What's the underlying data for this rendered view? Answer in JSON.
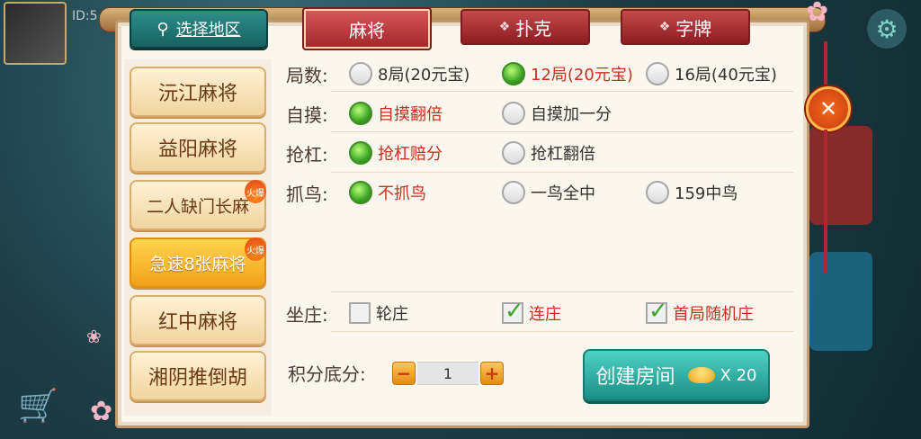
{
  "background": {
    "id_label": "ID:5",
    "gear_icon": "gear-icon"
  },
  "region_tab": {
    "label": "选择地区",
    "icon": "location-pin-icon"
  },
  "top_tabs": [
    {
      "label": "麻将",
      "active": true
    },
    {
      "label": "扑克",
      "active": false
    },
    {
      "label": "字牌",
      "active": false
    }
  ],
  "sidebar": {
    "items": [
      {
        "label": "沅江麻将",
        "active": false,
        "hot": false
      },
      {
        "label": "益阳麻将",
        "active": false,
        "hot": false
      },
      {
        "label": "二人缺门长麻",
        "active": false,
        "hot": true
      },
      {
        "label": "急速8张麻将",
        "active": true,
        "hot": true
      },
      {
        "label": "红中麻将",
        "active": false,
        "hot": false
      },
      {
        "label": "湘阴推倒胡",
        "active": false,
        "hot": false
      }
    ],
    "hot_badge": "火爆"
  },
  "settings": {
    "rounds": {
      "label": "局数:",
      "options": [
        "8局(20元宝)",
        "12局(20元宝)",
        "16局(40元宝)"
      ],
      "selected": 1
    },
    "self_draw": {
      "label": "自摸:",
      "options": [
        "自摸翻倍",
        "自摸加一分"
      ],
      "selected": 0
    },
    "kong": {
      "label": "抢杠:",
      "options": [
        "抢杠赔分",
        "抢杠翻倍"
      ],
      "selected": 0
    },
    "bird": {
      "label": "抓鸟:",
      "options": [
        "不抓鸟",
        "一鸟全中",
        "159中鸟"
      ],
      "selected": 0
    },
    "dealer": {
      "label": "坐庄:",
      "options": [
        "轮庄",
        "连庄",
        "首局随机庄"
      ],
      "checked": [
        false,
        true,
        true
      ]
    }
  },
  "score": {
    "label": "积分底分:",
    "value": "1",
    "minus": "−",
    "plus": "+"
  },
  "create_button": {
    "label": "创建房间",
    "cost": "X 20"
  },
  "close": {
    "label": "✕"
  }
}
